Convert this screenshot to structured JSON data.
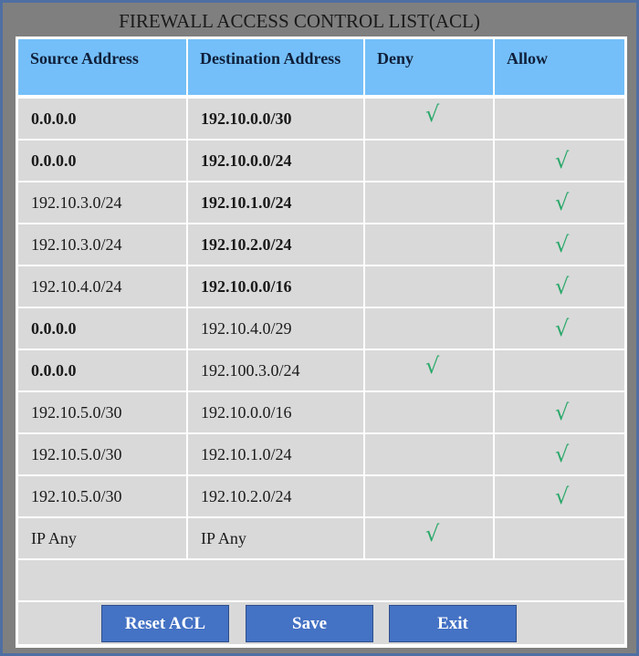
{
  "window": {
    "title": "FIREWALL ACCESS CONTROL LIST(ACL)"
  },
  "table": {
    "headers": [
      "Source Address",
      "Destination Address",
      "Deny",
      "Allow"
    ],
    "check_glyph": "√",
    "check_color": "#2aa86a",
    "rows": [
      {
        "source": "0.0.0.0",
        "source_bold": true,
        "destination": "192.10.0.0/30",
        "destination_bold": true,
        "action": "deny"
      },
      {
        "source": "0.0.0.0",
        "source_bold": true,
        "destination": "192.10.0.0/24",
        "destination_bold": true,
        "action": "allow"
      },
      {
        "source": "192.10.3.0/24",
        "source_bold": false,
        "destination": "192.10.1.0/24",
        "destination_bold": true,
        "action": "allow"
      },
      {
        "source": "192.10.3.0/24",
        "source_bold": false,
        "destination": "192.10.2.0/24",
        "destination_bold": true,
        "action": "allow"
      },
      {
        "source": "192.10.4.0/24",
        "source_bold": false,
        "destination": "192.10.0.0/16",
        "destination_bold": true,
        "action": "allow"
      },
      {
        "source": "0.0.0.0",
        "source_bold": true,
        "destination": "192.10.4.0/29",
        "destination_bold": false,
        "action": "allow"
      },
      {
        "source": "0.0.0.0",
        "source_bold": true,
        "destination": "192.100.3.0/24",
        "destination_bold": false,
        "action": "deny"
      },
      {
        "source": "192.10.5.0/30",
        "source_bold": false,
        "destination": "192.10.0.0/16",
        "destination_bold": false,
        "action": "allow"
      },
      {
        "source": "192.10.5.0/30",
        "source_bold": false,
        "destination": "192.10.1.0/24",
        "destination_bold": false,
        "action": "allow"
      },
      {
        "source": "192.10.5.0/30",
        "source_bold": false,
        "destination": "192.10.2.0/24",
        "destination_bold": false,
        "action": "allow"
      },
      {
        "source": "IP Any",
        "source_bold": false,
        "destination": "IP Any",
        "destination_bold": false,
        "action": "deny"
      }
    ]
  },
  "buttons": {
    "reset": "Reset ACL",
    "save": "Save",
    "exit": "Exit"
  },
  "colors": {
    "header_bg": "#74bff9",
    "button_bg": "#4472c4",
    "cell_bg": "#d9d9d9"
  }
}
